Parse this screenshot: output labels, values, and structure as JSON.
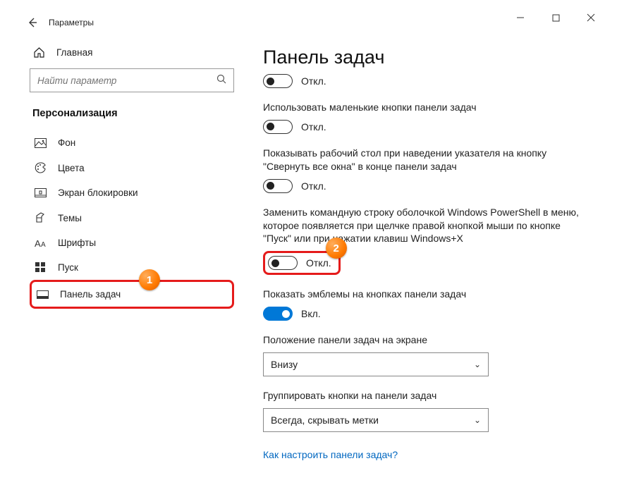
{
  "window": {
    "title": "Параметры"
  },
  "sidebar": {
    "home_label": "Главная",
    "search_placeholder": "Найти параметр",
    "category": "Персонализация",
    "items": [
      {
        "label": "Фон"
      },
      {
        "label": "Цвета"
      },
      {
        "label": "Экран блокировки"
      },
      {
        "label": "Темы"
      },
      {
        "label": "Шрифты"
      },
      {
        "label": "Пуск"
      },
      {
        "label": "Панель задач"
      }
    ]
  },
  "badges": {
    "one": "1",
    "two": "2"
  },
  "main": {
    "title": "Панель задач",
    "settings": [
      {
        "state": "Откл."
      },
      {
        "label": "Использовать маленькие кнопки панели задач",
        "state": "Откл."
      },
      {
        "label": "Показывать рабочий стол при наведении указателя на кнопку \"Свернуть все окна\" в конце панели задач",
        "state": "Откл."
      },
      {
        "label": "Заменить командную строку оболочкой Windows PowerShell в меню, которое появляется при щелчке правой кнопкой мыши по кнопке \"Пуск\" или при нажатии клавиш Windows+X",
        "state": "Откл."
      },
      {
        "label": "Показать эмблемы на кнопках панели задач",
        "state": "Вкл."
      }
    ],
    "position": {
      "label": "Положение панели задач на экране",
      "value": "Внизу"
    },
    "grouping": {
      "label": "Группировать кнопки на панели задач",
      "value": "Всегда, скрывать метки"
    },
    "help_link": "Как настроить панели задач?"
  }
}
